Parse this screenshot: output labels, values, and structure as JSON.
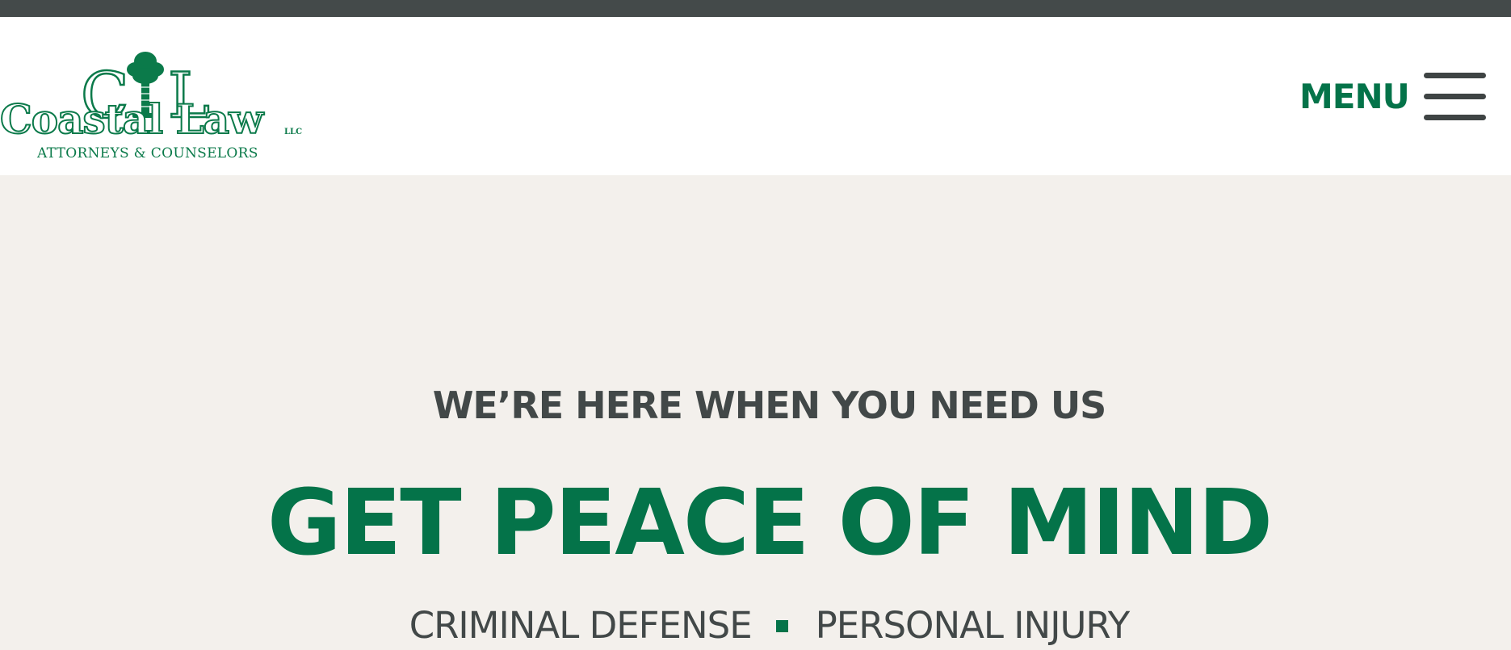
{
  "header": {
    "logo": {
      "monogram_left": "C",
      "monogram_right": "L",
      "brand": "Coastal Law",
      "suffix": "LLC",
      "tagline": "ATTORNEYS & COUNSELORS"
    },
    "menu_label": "MENU",
    "menu_icon": "hamburger-icon"
  },
  "hero": {
    "kicker": "WE’RE HERE WHEN YOU NEED US",
    "headline": "GET PEACE OF MIND",
    "services": [
      "CRIMINAL DEFENSE",
      "PERSONAL INJURY"
    ]
  },
  "colors": {
    "brand_green": "#047349",
    "text_dark": "#424848",
    "top_bar": "#444a4a",
    "hero_background": "#f3f0ec",
    "header_background": "#ffffff"
  }
}
